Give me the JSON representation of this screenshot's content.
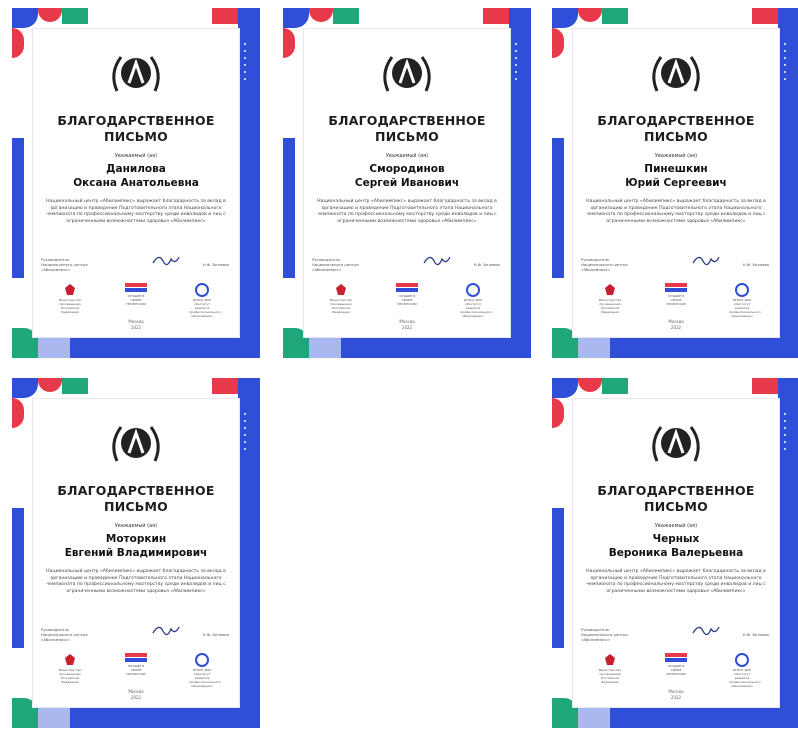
{
  "common": {
    "title_line1": "БЛАГОДАРСТВЕННОЕ",
    "title_line2": "ПИСЬМО",
    "body_text": "Национальный центр «Абилимпикс» выражает благодарность за вклад в организацию и проведение Подготовительного этапа Национального чемпионата по профессиональному мастерству среди инвалидов и лиц с ограниченными возможностями здоровья «Абилимпикс»",
    "signer_label": "Руководитель Национального центра «Абилимпикс»",
    "signer_name": "Н.Ф. Беляева",
    "logo_ministry": "Министерство просвещения Российской Федерации",
    "logo_abilympics": "ЛУЧШИЕ В СВОЕЙ ПРОФЕССИИ",
    "logo_center": "ФГБОУ ДПО «Институт развития профессионального образования»",
    "city": "Москва",
    "year": "2022",
    "colors": {
      "blue": "#2f4fd8",
      "red": "#e8394a",
      "green": "#1fa67a",
      "light": "#a9b9f0"
    }
  },
  "certificates": [
    {
      "respect": "Уважаемый (ая)",
      "name_line1": "Данилова",
      "name_line2": "Оксана Анатольевна"
    },
    {
      "respect": "Уважаемый (ая)",
      "name_line1": "Смородинов",
      "name_line2": "Сергей Иванович"
    },
    {
      "respect": "Уважаемый (ая)",
      "name_line1": "Пинешкин",
      "name_line2": "Юрий Сергеевич"
    },
    {
      "respect": "Уважаемый (ая)",
      "name_line1": "Моторкин",
      "name_line2": "Евгений Владимирович"
    },
    {
      "respect": "Уважаемый (ая)",
      "name_line1": "Черных",
      "name_line2": "Вероника Валерьевна"
    }
  ]
}
